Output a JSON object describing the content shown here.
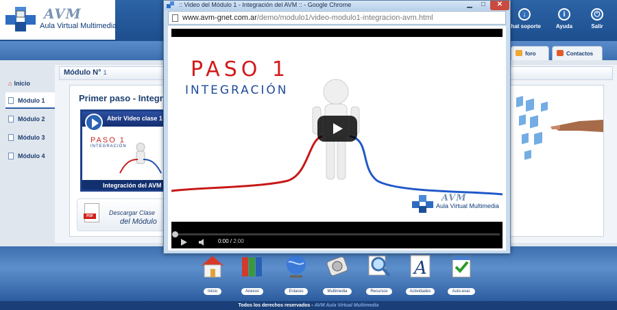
{
  "app": {
    "logo_text": "Aula Virtual Multimedia",
    "logo_mark": "AVM"
  },
  "top_icons": [
    {
      "label": "chat soporte",
      "icon": "chat-icon"
    },
    {
      "label": "Ayuda",
      "icon": "info-icon"
    },
    {
      "label": "Salir",
      "icon": "power-icon"
    }
  ],
  "tabs": [
    {
      "label": "foro",
      "icon": "forum-icon"
    },
    {
      "label": "Contactos",
      "icon": "contacts-icon"
    }
  ],
  "sidebar": {
    "items": [
      {
        "label": "Inicio",
        "active": false
      },
      {
        "label": "Módulo 1",
        "active": true
      },
      {
        "label": "Módulo 2",
        "active": false
      },
      {
        "label": "Módulo 3",
        "active": false
      },
      {
        "label": "Módulo 4",
        "active": false
      }
    ]
  },
  "main": {
    "module_header": "Módulo N°",
    "module_number": "1",
    "section_title": "Primer paso - Integr",
    "video_card": {
      "header": "Abrir Video clase 1",
      "thumb_title_1": "PASO 1",
      "thumb_title_2": "INTEGRACIÓN",
      "footer": "Integración del AVM"
    },
    "download": {
      "line1": "Descargar Clase",
      "line2": "del Módulo",
      "badge": "PDF"
    }
  },
  "bottom_nav": [
    {
      "label": "Inicio",
      "icon": "house-icon"
    },
    {
      "label": "Anexos",
      "icon": "binders-icon"
    },
    {
      "label": "Enlaces",
      "icon": "globe-icon"
    },
    {
      "label": "Multimedia",
      "icon": "media-icon"
    },
    {
      "label": "Recursos",
      "icon": "magnifier-icon"
    },
    {
      "label": "Actividades",
      "icon": "font-icon"
    },
    {
      "label": "Auto-eval.",
      "icon": "checklist-icon"
    }
  ],
  "footer": {
    "text": "Todos los derechos reservados - ",
    "brand": "AVM Aula Virtual Multimedia"
  },
  "popup": {
    "window_title": ":: Video del Módulo 1 - Integración del AVM :: - Google Chrome",
    "url_host": "www.avm-gnet.com.ar",
    "url_path": "/demo/modulo1/video-modulo1-integracion-avm.html",
    "video": {
      "title_1": "PASO 1",
      "title_2": "INTEGRACIÓN",
      "watermark_mark": "AVM",
      "watermark_text": "Aula Virtual Multimedia",
      "current_time": "0:00",
      "duration": "2:00",
      "progress": 0
    },
    "colors": {
      "accent_red": "#d11a1a",
      "accent_blue": "#1e4a9a"
    }
  }
}
